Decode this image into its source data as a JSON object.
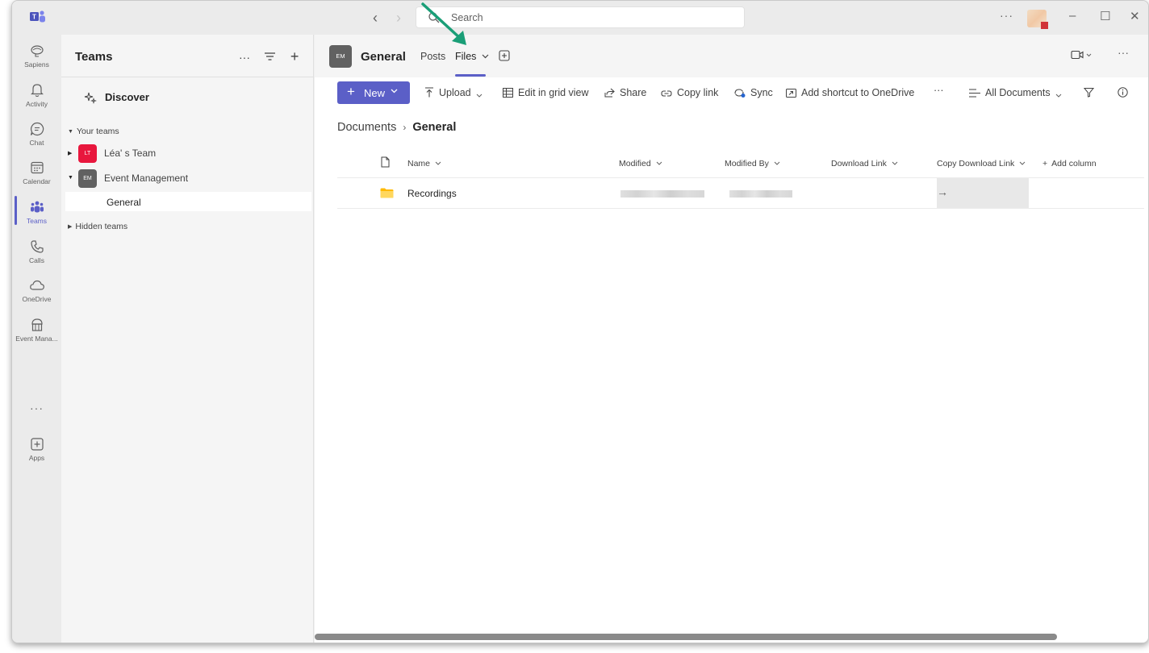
{
  "titlebar": {
    "search_placeholder": "Search",
    "more": "···"
  },
  "rail": {
    "items": [
      {
        "label": "Sapiens",
        "icon": "sapiens-icon"
      },
      {
        "label": "Activity",
        "icon": "bell-icon"
      },
      {
        "label": "Chat",
        "icon": "chat-icon"
      },
      {
        "label": "Calendar",
        "icon": "calendar-icon"
      },
      {
        "label": "Teams",
        "icon": "teams-icon"
      },
      {
        "label": "Calls",
        "icon": "phone-icon"
      },
      {
        "label": "OneDrive",
        "icon": "cloud-icon"
      },
      {
        "label": "Event Mana...",
        "icon": "event-icon"
      },
      {
        "label": "Apps",
        "icon": "apps-icon"
      }
    ],
    "more": "···",
    "active_color": "#5b5fc7"
  },
  "panel": {
    "title": "Teams",
    "discover": "Discover",
    "your_teams": "Your teams",
    "teams": [
      {
        "name": "Léa' s Team",
        "initials": "LT",
        "color": "#e8173d"
      },
      {
        "name": "Event Management",
        "initials": "EM",
        "color": "#616161"
      }
    ],
    "channel": "General",
    "hidden_teams": "Hidden teams"
  },
  "channel": {
    "initials": "EM",
    "name": "General",
    "tabs": [
      {
        "label": "Posts"
      },
      {
        "label": "Files",
        "active": true
      }
    ]
  },
  "commands": {
    "new": "New",
    "upload": "Upload",
    "edit_grid": "Edit in grid view",
    "share": "Share",
    "copy_link": "Copy link",
    "sync": "Sync",
    "shortcut": "Add shortcut to OneDrive",
    "more": "···",
    "view": "All Documents"
  },
  "breadcrumb": {
    "root": "Documents",
    "current": "General"
  },
  "table": {
    "columns": [
      "Name",
      "Modified",
      "Modified By",
      "Download Link",
      "Copy Download Link"
    ],
    "add_column": "Add column",
    "rows": [
      {
        "name": "Recordings",
        "type": "folder"
      }
    ]
  },
  "colors": {
    "accent": "#5b5fc7",
    "annotation_arrow": "#1a9e77"
  }
}
